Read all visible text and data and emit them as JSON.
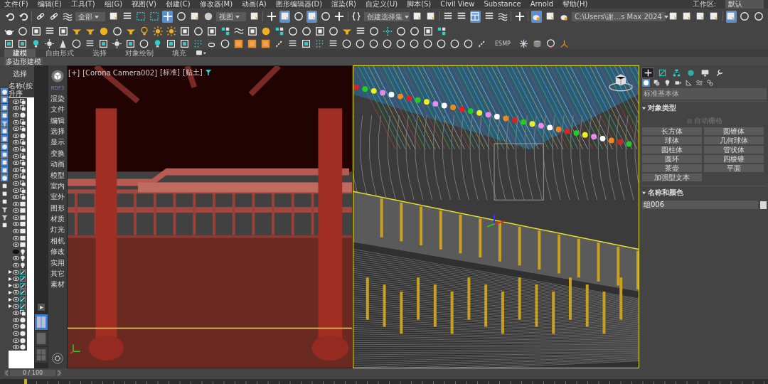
{
  "menu": [
    "文件(F)",
    "编辑(E)",
    "工具(T)",
    "组(G)",
    "视图(V)",
    "创建(C)",
    "修改器(M)",
    "动画(A)",
    "图形编辑器(D)",
    "渲染(R)",
    "自定义(U)",
    "脚本(S)",
    "Civil View",
    "Substance",
    "Arnold",
    "帮助(H)"
  ],
  "workspace": {
    "label": "工作区:",
    "value": "默认"
  },
  "toolbar_1": [
    {
      "kind": "button",
      "selected": false
    },
    {
      "kind": "button",
      "selected": false
    },
    {
      "kind": "separator"
    },
    {
      "kind": "button",
      "selected": false
    },
    {
      "kind": "button",
      "selected": false
    },
    {
      "kind": "button",
      "selected": false
    },
    {
      "kind": "dropdown",
      "value": "全部"
    },
    {
      "kind": "button",
      "selected": false
    },
    {
      "kind": "button",
      "selected": false
    },
    {
      "kind": "button",
      "selected": false
    },
    {
      "kind": "button",
      "selected": false
    },
    {
      "kind": "button",
      "selected": true
    },
    {
      "kind": "button",
      "selected": false
    },
    {
      "kind": "button",
      "selected": false
    },
    {
      "kind": "button",
      "selected": false
    },
    {
      "kind": "dropdown",
      "value": "视图"
    },
    {
      "kind": "button",
      "selected": false
    },
    {
      "kind": "separator"
    },
    {
      "kind": "button",
      "selected": false
    },
    {
      "kind": "button",
      "selected": true
    },
    {
      "kind": "button",
      "selected": false
    },
    {
      "kind": "button",
      "selected": true
    },
    {
      "kind": "button",
      "selected": false
    },
    {
      "kind": "button",
      "selected": false
    },
    {
      "kind": "separator"
    },
    {
      "kind": "button",
      "selected": false
    },
    {
      "kind": "dropdown",
      "value": "创建选择集"
    },
    {
      "kind": "button",
      "selected": false
    },
    {
      "kind": "button",
      "selected": false
    },
    {
      "kind": "separator"
    },
    {
      "kind": "button",
      "selected": false
    },
    {
      "kind": "button",
      "selected": false
    },
    {
      "kind": "button",
      "selected": true
    },
    {
      "kind": "button",
      "selected": false
    },
    {
      "kind": "button",
      "selected": false
    },
    {
      "kind": "separator"
    },
    {
      "kind": "button",
      "selected": false
    },
    {
      "kind": "separator"
    },
    {
      "kind": "button",
      "selected": true
    },
    {
      "kind": "button",
      "selected": false
    },
    {
      "kind": "button",
      "selected": false
    },
    {
      "kind": "dropdown",
      "value": "C:\\Users\\谢…s Max 2024"
    },
    {
      "kind": "button",
      "selected": false
    },
    {
      "kind": "button",
      "selected": false
    },
    {
      "kind": "button",
      "selected": false
    },
    {
      "kind": "button",
      "selected": false
    },
    {
      "kind": "separator"
    },
    {
      "kind": "button",
      "selected": true
    },
    {
      "kind": "button",
      "selected": false
    },
    {
      "kind": "button",
      "selected": false
    }
  ],
  "toolbar_3_label": "ESMP",
  "ribbon": {
    "tabs": [
      {
        "label": "建模",
        "selected": true
      },
      {
        "label": "自由形式",
        "selected": false
      },
      {
        "label": "选择",
        "selected": false
      },
      {
        "label": "对象绘制",
        "selected": false
      },
      {
        "label": "填充",
        "selected": false
      }
    ],
    "panel": "多边形建模"
  },
  "filters": [
    {
      "on": true
    },
    {
      "on": true
    },
    {
      "on": true
    },
    {
      "on": true
    },
    {
      "on": true
    },
    {
      "on": true
    },
    {
      "on": true
    },
    {
      "on": true
    },
    {
      "on": true
    },
    {
      "on": true
    },
    {
      "on": true
    },
    {
      "on": true
    },
    {
      "on": false
    },
    {
      "on": false
    },
    {
      "on": false
    },
    {
      "on": false
    },
    {
      "on": false
    },
    {
      "on": false
    }
  ],
  "scene_explorer": {
    "title": "选择",
    "column": "名称(按升序",
    "rows": [
      {
        "kind": "group",
        "visible": true,
        "has_children": false
      },
      {
        "kind": "group",
        "visible": true,
        "has_children": false
      },
      {
        "kind": "sphere",
        "visible": true,
        "has_children": false
      },
      {
        "kind": "group",
        "visible": true,
        "has_children": false
      },
      {
        "kind": "group",
        "visible": true,
        "has_children": false
      },
      {
        "kind": "sphere",
        "visible": true,
        "has_children": false
      },
      {
        "kind": "group",
        "visible": true,
        "has_children": false
      },
      {
        "kind": "group",
        "visible": true,
        "has_children": false
      },
      {
        "kind": "group",
        "visible": true,
        "has_children": false
      },
      {
        "kind": "group",
        "visible": true,
        "has_children": false
      },
      {
        "kind": "group",
        "visible": true,
        "has_children": false
      },
      {
        "kind": "group",
        "visible": true,
        "has_children": false
      },
      {
        "kind": "group",
        "visible": true,
        "has_children": false
      },
      {
        "kind": "group",
        "visible": true,
        "has_children": false
      },
      {
        "kind": "group",
        "visible": true,
        "has_children": false
      },
      {
        "kind": "box",
        "visible": true,
        "has_children": false
      },
      {
        "kind": "box",
        "visible": true,
        "has_children": false
      },
      {
        "kind": "box",
        "visible": true,
        "has_children": false
      },
      {
        "kind": "box",
        "visible": true,
        "has_children": false
      },
      {
        "kind": "box",
        "visible": true,
        "has_children": false
      },
      {
        "kind": "box",
        "visible": true,
        "has_children": false
      },
      {
        "kind": "box",
        "visible": true,
        "has_children": false
      },
      {
        "kind": "light",
        "visible": false,
        "has_children": false
      },
      {
        "kind": "light",
        "visible": true,
        "has_children": false
      },
      {
        "kind": "light",
        "visible": true,
        "has_children": false
      },
      {
        "kind": "shape",
        "visible": true,
        "has_children": true
      },
      {
        "kind": "shape",
        "visible": true,
        "has_children": true
      },
      {
        "kind": "shape",
        "visible": true,
        "has_children": true
      },
      {
        "kind": "shape",
        "visible": true,
        "has_children": true
      },
      {
        "kind": "shape",
        "visible": true,
        "has_children": true
      },
      {
        "kind": "shape",
        "visible": true,
        "has_children": true
      },
      {
        "kind": "group",
        "visible": true,
        "has_children": false
      },
      {
        "kind": "sphere",
        "visible": true,
        "has_children": false
      },
      {
        "kind": "sphere",
        "visible": true,
        "has_children": false
      },
      {
        "kind": "sphere",
        "visible": true,
        "has_children": false
      },
      {
        "kind": "sphere",
        "visible": true,
        "has_children": false
      },
      {
        "kind": "sphere",
        "visible": true,
        "has_children": false
      }
    ]
  },
  "command_strip": {
    "title": "RDF3",
    "items": [
      "渲染",
      "文件",
      "编辑",
      "选择",
      "显示",
      "变换",
      "动画",
      "模型",
      "室内",
      "室外",
      "图形",
      "材质",
      "灯光",
      "相机",
      "修改",
      "实用",
      "其它",
      "素材"
    ]
  },
  "layouts": [
    {
      "selected": true
    },
    {
      "selected": false
    },
    {
      "selected": false
    }
  ],
  "viewport_left": {
    "labels": [
      "[+]",
      "[Corona Camera002]",
      "[标准]",
      "[贴土]"
    ],
    "active": false
  },
  "viewport_right": {
    "active": true
  },
  "command_panel": {
    "tabs": [
      {
        "selected": true
      },
      {
        "selected": false
      },
      {
        "selected": false
      },
      {
        "selected": false
      },
      {
        "selected": false
      },
      {
        "selected": false
      }
    ],
    "categories": [
      {
        "selected": true
      },
      {
        "selected": false
      },
      {
        "selected": false
      },
      {
        "selected": false
      },
      {
        "selected": false
      },
      {
        "selected": false
      },
      {
        "selected": false
      }
    ],
    "dropdown": "标准基本体",
    "object_type": {
      "title": "对象类型",
      "auto_grid": {
        "label": "自动栅格",
        "checked": false,
        "disabled": true
      },
      "buttons": [
        "长方体",
        "圆锥体",
        "球体",
        "几何球体",
        "圆柱体",
        "管状体",
        "圆环",
        "四棱锥",
        "茶壶",
        "平面",
        "加强型文本"
      ]
    },
    "name_color": {
      "title": "名称和颜色",
      "name": "组006"
    }
  },
  "time_slider": {
    "label": "0 / 100",
    "level": 0
  }
}
